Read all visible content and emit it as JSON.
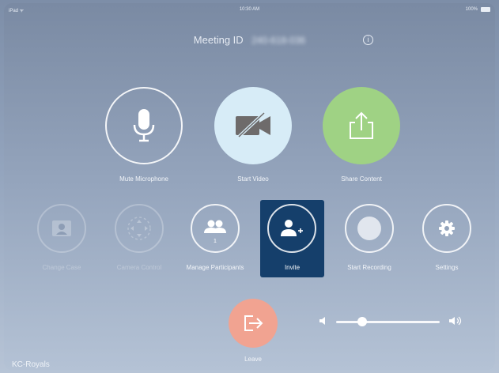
{
  "status_bar": {
    "carrier": "iPad ᯤ",
    "time": "10:30 AM",
    "battery_text": "100%"
  },
  "meeting": {
    "label": "Meeting ID",
    "id_blurred": "240-618-036",
    "info_icon": "info-icon"
  },
  "primary_actions": [
    {
      "label": "Mute Microphone",
      "icon": "microphone-icon"
    },
    {
      "label": "Start Video",
      "icon": "video-camera-off-icon"
    },
    {
      "label": "Share Content",
      "icon": "share-icon"
    }
  ],
  "secondary_actions": [
    {
      "label": "Change Case",
      "icon": "camera-case-icon",
      "enabled": false
    },
    {
      "label": "Camera Control",
      "icon": "camera-control-icon",
      "enabled": false
    },
    {
      "label": "Manage Participants",
      "icon": "participants-icon",
      "badge": "1"
    },
    {
      "label": "Invite",
      "icon": "add-person-icon",
      "selected": true
    },
    {
      "label": "Start Recording",
      "icon": "record-icon"
    },
    {
      "label": "Settings",
      "icon": "gear-icon"
    }
  ],
  "leave": {
    "label": "Leave",
    "icon": "leave-icon"
  },
  "volume": {
    "level": 0.25,
    "min_icon": "volume-low-icon",
    "max_icon": "volume-high-icon"
  },
  "room": {
    "name": "KC-Royals"
  },
  "colors": {
    "invite_tile": "#153f6b",
    "video_button": "#d7ecf7",
    "share_button": "#9fd284",
    "leave_button": "#f1a391"
  }
}
